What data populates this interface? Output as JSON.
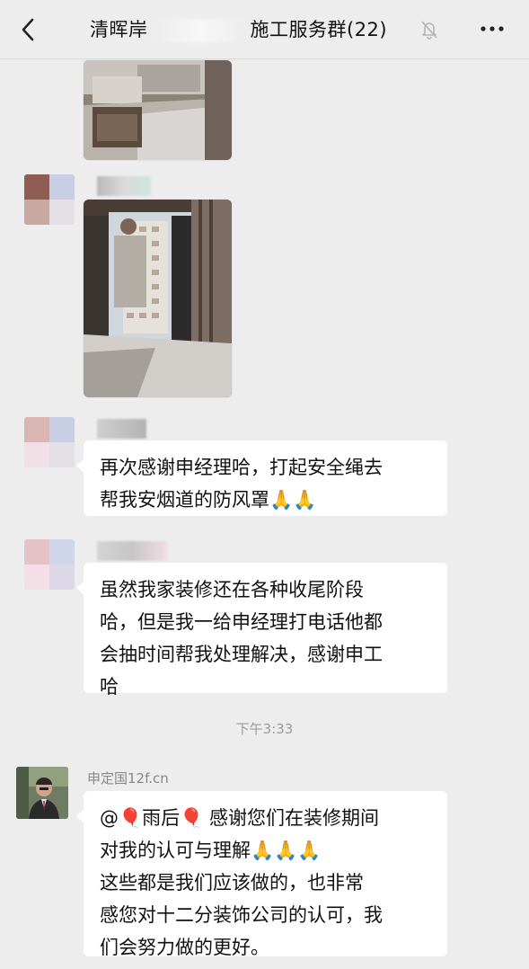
{
  "header": {
    "title_left": "清晖岸",
    "title_right": "施工服务群(22)"
  },
  "messages": [
    {
      "type": "image",
      "description": "photo"
    },
    {
      "type": "image",
      "description": "photo"
    },
    {
      "type": "text",
      "lines": [
        "再次感谢申经理哈，打起安全绳去",
        "帮我安烟道的防风罩🙏🙏"
      ]
    },
    {
      "type": "text",
      "lines": [
        "虽然我家装修还在各种收尾阶段",
        "哈，但是我一给申经理打电话他都",
        "会抽时间帮我处理解决，感谢申工",
        "哈"
      ]
    }
  ],
  "timestamp": "下午3:33",
  "reply": {
    "sender": "申定国12f.cn",
    "lines": [
      "@🎈雨后🎈  感谢您们在装修期间",
      "对我的认可与理解🙏🙏🙏",
      "  这些都是我们应该做的，也非常",
      "感您对十二分装饰公司的认可，我",
      "们会努力做的更好。"
    ]
  },
  "colors": {
    "background": "#ededed",
    "bubble": "#ffffff",
    "text": "#111111",
    "meta": "#9b9b9b"
  }
}
